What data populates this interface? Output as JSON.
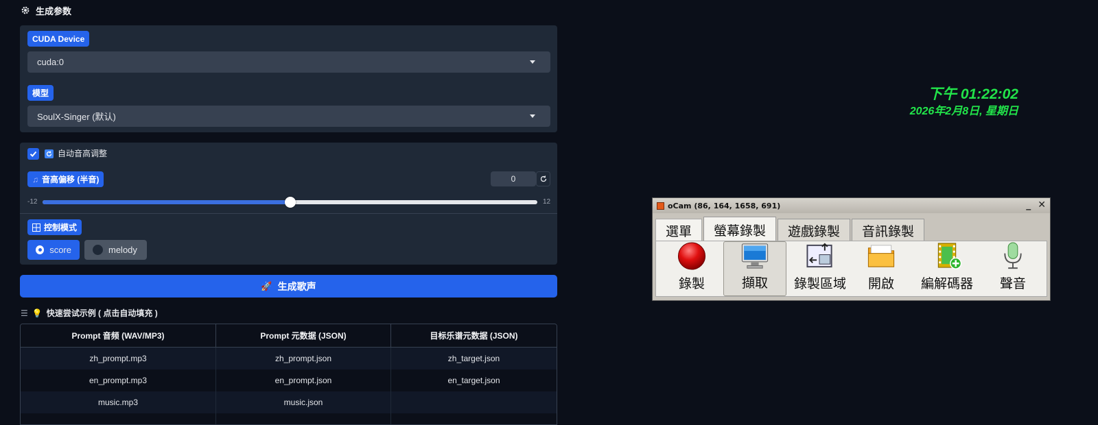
{
  "section": {
    "title": "生成参数",
    "icon": "gear-icon"
  },
  "cuda": {
    "label": "CUDA Device",
    "value": "cuda:0"
  },
  "model": {
    "label": "模型",
    "value": "SoulX-Singer (默认)"
  },
  "pitch": {
    "auto_checked": true,
    "auto_label": "自动音高调整",
    "shift_label": "音高偏移 (半音)",
    "shift_value": "0",
    "min": "-12",
    "max": "12",
    "level_fraction": 0.5
  },
  "control": {
    "label": "控制模式",
    "options": [
      "score",
      "melody"
    ],
    "selected": "score"
  },
  "generate_button": "生成歌声",
  "examples": {
    "title": "快速尝试示例 ( 点击自动填充 )",
    "headers": [
      "Prompt 音频 (WAV/MP3)",
      "Prompt 元数据 (JSON)",
      "目标乐谱元数据 (JSON)"
    ],
    "rows": [
      [
        "zh_prompt.mp3",
        "zh_prompt.json",
        "zh_target.json"
      ],
      [
        "en_prompt.mp3",
        "en_prompt.json",
        "en_target.json"
      ],
      [
        "music.mp3",
        "music.json",
        ""
      ]
    ]
  },
  "clock": {
    "time": "下午 01:22:02",
    "date": "2026年2月8日, 星期日",
    "color": "#22e44a"
  },
  "ocam": {
    "title": "oCam (86, 164, 1658, 691)",
    "tabs": [
      "選單",
      "螢幕錄製",
      "遊戲錄製",
      "音訊錄製"
    ],
    "active_tab": "螢幕錄製",
    "tools": [
      "錄製",
      "擷取",
      "錄製區域",
      "開啟",
      "編解碼器",
      "聲音"
    ],
    "pressed_tool": "擷取"
  },
  "colors": {
    "accent": "#2563eb",
    "panel": "#1f2937",
    "background": "#0b0f19"
  }
}
